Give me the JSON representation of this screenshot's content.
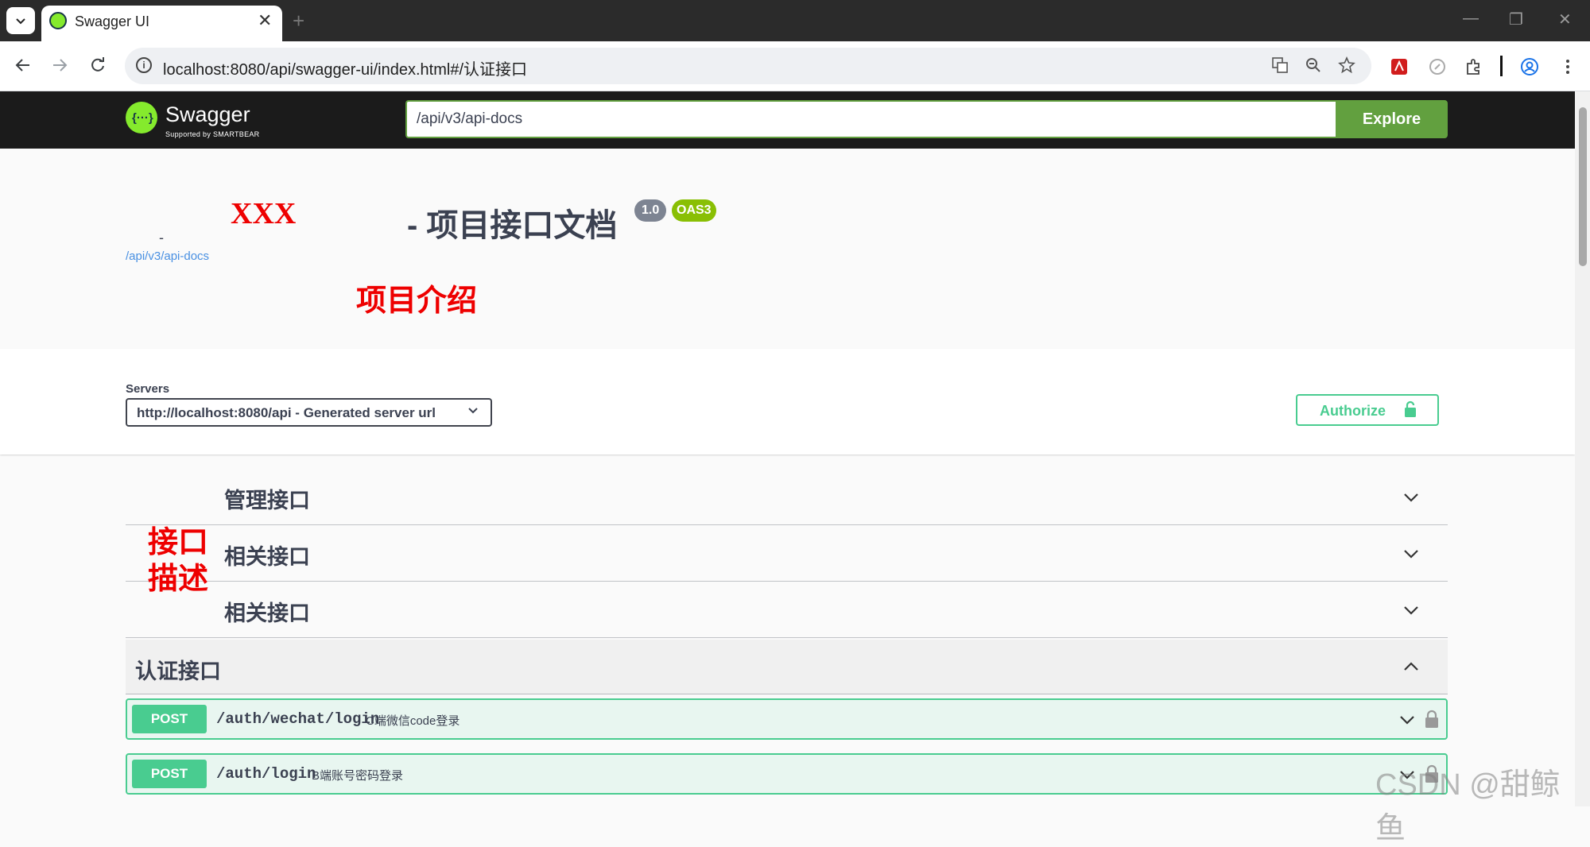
{
  "browser": {
    "tab_title": "Swagger UI",
    "tab_close": "✕",
    "new_tab": "+",
    "url": "localhost:8080/api/swagger-ui/index.html#/认证接口",
    "window_controls": [
      "—",
      "❐",
      "✕"
    ]
  },
  "swagger": {
    "logo_name": "Swagger",
    "logo_sub": "Supported by SMARTBEAR",
    "spec_url": "/api/v3/api-docs",
    "explore_label": "Explore"
  },
  "info": {
    "name": "XXX",
    "title": "- 项目接口文档",
    "version": "1.0",
    "oas": "OAS3",
    "dash": "-",
    "spec_link": "/api/v3/api-docs",
    "description": "项目介绍"
  },
  "scheme": {
    "servers_label": "Servers",
    "selected_server": "http://localhost:8080/api - Generated server url",
    "authorize_label": "Authorize"
  },
  "tags": {
    "note": "接口描述",
    "items": [
      {
        "title": "管理接口"
      },
      {
        "title": "相关接口"
      },
      {
        "title": "相关接口"
      },
      {
        "title": "认证接口"
      }
    ]
  },
  "operations": [
    {
      "method": "POST",
      "path": "/auth/wechat/login",
      "summary": "C端微信code登录"
    },
    {
      "method": "POST",
      "path": "/auth/login",
      "summary": "B端账号密码登录"
    }
  ],
  "watermark": "CSDN @甜鲸鱼",
  "colors": {
    "swagger_green": "#85ea2d",
    "explore_green": "#62a03f",
    "post_green": "#49cc90",
    "annotation_red": "#ee0000",
    "text_dark": "#3b4151"
  }
}
